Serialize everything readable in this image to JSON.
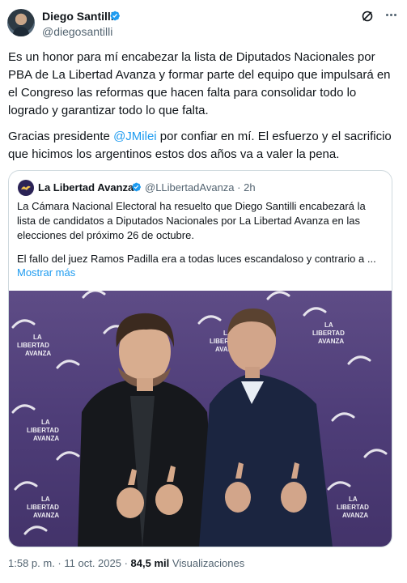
{
  "author": {
    "name": "Diego Santilli",
    "handle": "@diegosantilli"
  },
  "tweet": {
    "paragraph1": "Es un honor para mí encabezar la lista de Diputados Nacionales por PBA de La Libertad Avanza y formar parte del equipo que impulsará en el Congreso las reformas que hacen falta para consolidar todo lo logrado y garantizar todo lo que falta.",
    "paragraph2_before": "Gracias presidente ",
    "mention": "@JMilei",
    "paragraph2_after": " por confiar en mí. El esfuerzo y el sacrificio que hicimos los argentinos estos dos años va a valer la pena."
  },
  "quote": {
    "name": "La Libertad Avanza",
    "handle_time": "@LLibertadAvanza · 2h",
    "text1": "La Cámara Nacional Electoral ha resuelto que Diego Santilli encabezará la lista de candidatos a Diputados Nacionales por La Libertad Avanza en las elecciones del próximo 26 de octubre.",
    "text2": "El fallo del juez Ramos Padilla era a todas luces escandaloso y contrario a ...",
    "show_more": "Mostrar más"
  },
  "backdrop_logo": {
    "line1": "LA",
    "line2": "LIBERTAD",
    "line3": "AVANZA"
  },
  "meta": {
    "time": "1:58 p. m.",
    "separator": " · ",
    "date": "11 oct. 2025",
    "views_count": "84,5 mil",
    "views_label": " Visualizaciones"
  },
  "colors": {
    "accent": "#1d9bf0",
    "text": "#0f1419",
    "muted": "#536471",
    "border": "#cfd9de",
    "verified": "#1d9bf0",
    "backdrop": "#4e3d78"
  },
  "icons": [
    "verified-badge-icon",
    "grok-icon",
    "more-options-icon"
  ]
}
